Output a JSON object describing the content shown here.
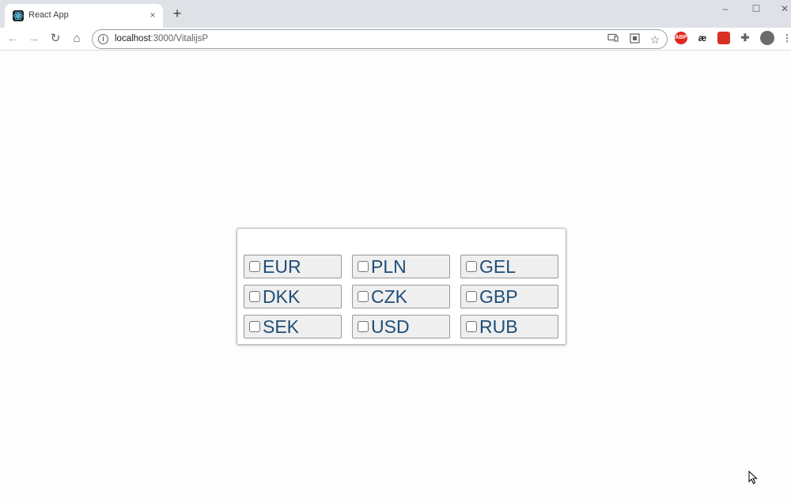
{
  "browser": {
    "tab_title": "React App",
    "tab_close": "×",
    "new_tab": "+",
    "window": {
      "minimize": "–",
      "maximize": "☐",
      "close": "✕"
    },
    "nav": {
      "back": "←",
      "forward": "→",
      "reload": "↻",
      "home": "⌂"
    },
    "address": {
      "host": "localhost",
      "path": ":3000/VitalijsP"
    },
    "extensions": [
      {
        "name": "adblock-extension",
        "label": "ABP",
        "color": "#e3261c"
      },
      {
        "name": "ae-extension",
        "label": "æ",
        "color": "#ffffff"
      },
      {
        "name": "red-extension",
        "label": "",
        "color": "#d93025"
      }
    ]
  },
  "currency_picker": {
    "options": [
      {
        "code": "EUR",
        "checked": false
      },
      {
        "code": "PLN",
        "checked": false
      },
      {
        "code": "GEL",
        "checked": false
      },
      {
        "code": "DKK",
        "checked": false
      },
      {
        "code": "CZK",
        "checked": false
      },
      {
        "code": "GBP",
        "checked": false
      },
      {
        "code": "SEK",
        "checked": false
      },
      {
        "code": "USD",
        "checked": false
      },
      {
        "code": "RUB",
        "checked": false
      }
    ]
  },
  "colors": {
    "label": "#1f4e79",
    "button_bg": "#efefef",
    "button_border": "#9a9a9a"
  }
}
